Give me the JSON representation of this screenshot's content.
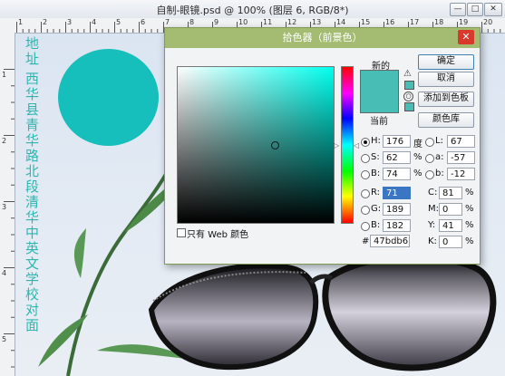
{
  "window": {
    "title": "自制-眼镜.psd @ 100% (图层 6, RGB/8*)",
    "min_label": "—",
    "max_label": "□",
    "close_label": "✕"
  },
  "rulers": {
    "h_numbers": [
      "1",
      "2",
      "3",
      "4",
      "5",
      "6",
      "7",
      "8",
      "9",
      "10",
      "11",
      "12",
      "13",
      "14",
      "15",
      "16",
      "17",
      "18",
      "19",
      "20"
    ],
    "v_numbers": [
      "1",
      "2",
      "3",
      "4",
      "5"
    ]
  },
  "canvas": {
    "text_col1": "地址",
    "text_col2": "西华县青华路北段清华中英文学校对面",
    "text_color": "#2bb7b0",
    "circle_color": "#16bfbb"
  },
  "picker": {
    "title": "拾色器（前景色）",
    "close_label": "✕",
    "new_label": "新的",
    "current_label": "当前",
    "new_color": "#47bdb6",
    "current_color": "#47bdb6",
    "ok_label": "确定",
    "cancel_label": "取消",
    "add_swatch_label": "添加到色板",
    "color_library_label": "颜色库",
    "web_only_label": "只有 Web 颜色",
    "hsb": [
      {
        "label": "H:",
        "value": "176",
        "unit": "度",
        "selected": true
      },
      {
        "label": "S:",
        "value": "62",
        "unit": "%",
        "selected": false
      },
      {
        "label": "B:",
        "value": "74",
        "unit": "%",
        "selected": false
      }
    ],
    "rgb": [
      {
        "label": "R:",
        "value": "71"
      },
      {
        "label": "G:",
        "value": "189"
      },
      {
        "label": "B:",
        "value": "182"
      }
    ],
    "lab": [
      {
        "label": "L:",
        "value": "67"
      },
      {
        "label": "a:",
        "value": "-57"
      },
      {
        "label": "b:",
        "value": "-12"
      }
    ],
    "cmyk": [
      {
        "label": "C:",
        "value": "81",
        "unit": "%"
      },
      {
        "label": "M:",
        "value": "0",
        "unit": "%"
      },
      {
        "label": "Y:",
        "value": "41",
        "unit": "%"
      },
      {
        "label": "K:",
        "value": "0",
        "unit": "%"
      }
    ],
    "hex_label": "#",
    "hex_value": "47bdb6",
    "hue_color": "#00ffee"
  }
}
